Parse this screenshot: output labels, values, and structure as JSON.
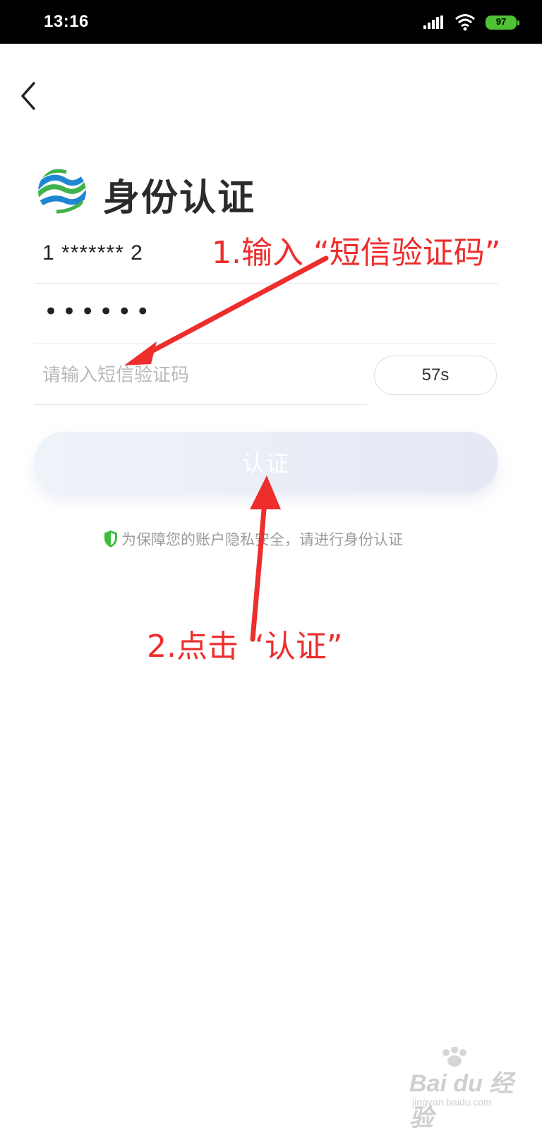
{
  "status_bar": {
    "time": "13:16",
    "battery": "97",
    "icons": [
      "signal-icon",
      "wifi-icon",
      "battery-icon"
    ],
    "battery_color": "#4fc235"
  },
  "header": {
    "title": "身份认证",
    "back_icon": "chevron-left-icon",
    "logo_icon": "china-mobile-logo"
  },
  "form": {
    "phone_value": "1 ******* 2",
    "password_value": "••••••",
    "code_placeholder": "请输入短信验证码",
    "code_value": "",
    "countdown_label": "57s",
    "submit_label": "认证"
  },
  "notice": {
    "text": "为保障您的账户隐私安全，请进行身份认证",
    "icon": "shield-icon",
    "icon_color": "#3dbb3d"
  },
  "annotations": [
    {
      "text": "1.输入 “短信验证码”"
    },
    {
      "text": "2.点击 “认证”"
    }
  ],
  "annotation_color": "#ee2d2d",
  "watermark": {
    "text": "Bai du 经验",
    "sub": "jingyan.baidu.com"
  }
}
